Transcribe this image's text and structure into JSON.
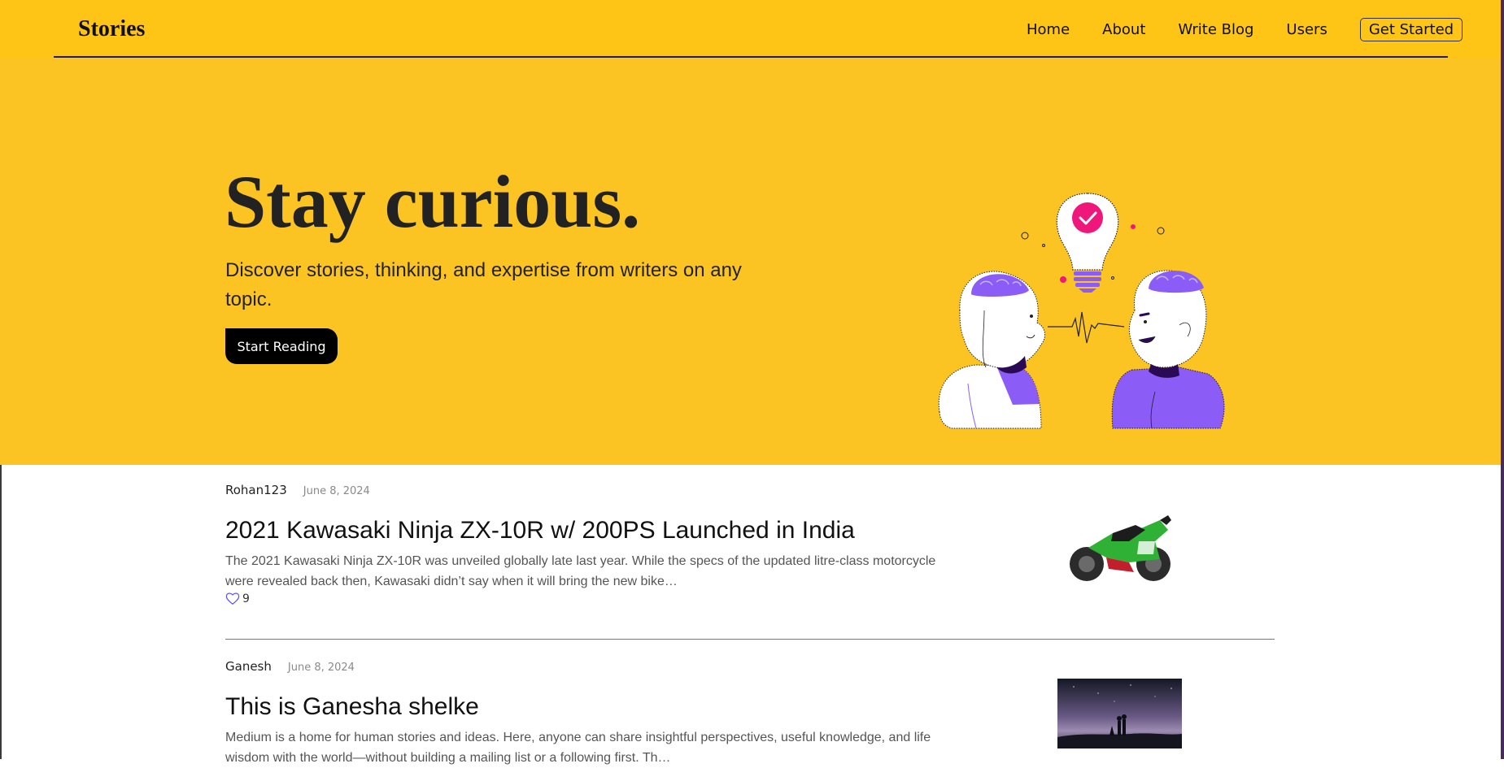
{
  "nav": {
    "brand": "Stories",
    "links": [
      "Home",
      "About",
      "Write Blog",
      "Users"
    ],
    "cta": "Get Started"
  },
  "hero": {
    "title": "Stay curious.",
    "subtitle": "Discover stories, thinking, and expertise from writers on any topic.",
    "button": "Start Reading",
    "illustration": "two-heads-idea-lightbulb"
  },
  "articles": [
    {
      "author": "Rohan123",
      "date": "June 8, 2024",
      "title": "2021 Kawasaki Ninja ZX-10R w/ 200PS Launched in India",
      "excerpt": "The 2021 Kawasaki Ninja ZX-10R was unveiled globally late last year. While the specs of the updated litre-class motorcycle were revealed back then, Kawasaki didn’t say when it will bring the new bike…",
      "likes": "9",
      "thumbnail": "green-motorcycle"
    },
    {
      "author": "Ganesh",
      "date": "June 8, 2024",
      "title": "This is Ganesha shelke",
      "excerpt": "Medium is a home for human stories and ideas. Here, anyone can share insightful perspectives, useful knowledge, and life wisdom with the world—without building a mailing list or a following first. Th…",
      "thumbnail": "night-sky-silhouettes"
    }
  ],
  "colors": {
    "navbar": "#fec517",
    "hero": "#fcc423",
    "accent_purple": "#8b5cf6",
    "accent_pink": "#f0177a"
  }
}
